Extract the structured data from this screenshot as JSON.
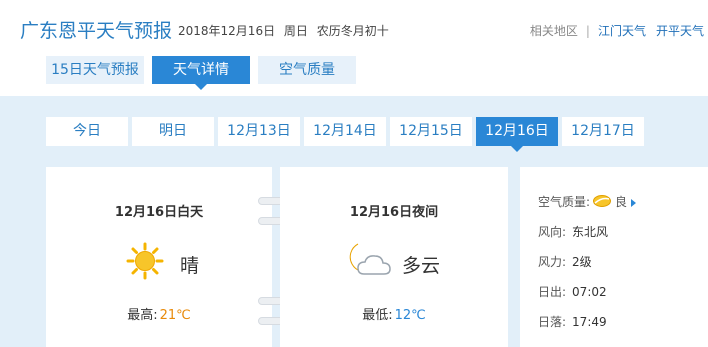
{
  "header": {
    "title": "广东恩平天气预报",
    "date": "2018年12月16日",
    "weekday": "周日",
    "lunar": "农历冬月初十",
    "related_label": "相关地区",
    "related_sep": "|",
    "related_links": [
      "江门天气",
      "开平天气"
    ]
  },
  "top_tabs": [
    {
      "label": "15日天气预报",
      "active": false
    },
    {
      "label": "天气详情",
      "active": true
    },
    {
      "label": "空气质量",
      "active": false
    }
  ],
  "day_tabs": [
    {
      "label": "今日",
      "active": false
    },
    {
      "label": "明日",
      "active": false
    },
    {
      "label": "12月13日",
      "active": false
    },
    {
      "label": "12月14日",
      "active": false
    },
    {
      "label": "12月15日",
      "active": false
    },
    {
      "label": "12月16日",
      "active": true
    },
    {
      "label": "12月17日",
      "active": false
    }
  ],
  "day_card": {
    "title": "12月16日白天",
    "icon": "sun-icon",
    "weather": "晴",
    "temp_label": "最高:",
    "temp_value": "21℃"
  },
  "night_card": {
    "title": "12月16日夜间",
    "icon": "moon-cloud-icon",
    "weather": "多云",
    "temp_label": "最低:",
    "temp_value": "12℃"
  },
  "details": {
    "aq_label": "空气质量:",
    "aq_icon": "aqi-good-icon",
    "aq_value": "良",
    "wind_dir_label": "风向:",
    "wind_dir_value": "东北风",
    "wind_force_label": "风力:",
    "wind_force_value": "2级",
    "sunrise_label": "日出:",
    "sunrise_value": "07:02",
    "sunset_label": "日落:",
    "sunset_value": "17:49"
  },
  "colors": {
    "accent": "#2a87d6",
    "title_blue": "#2a7ec2",
    "tab_inactive_bg": "#e7f1fa",
    "main_bg": "#e2eff9",
    "max_temp": "#e88a0a",
    "min_temp": "#2a87d6",
    "sun": "#f5b400"
  }
}
